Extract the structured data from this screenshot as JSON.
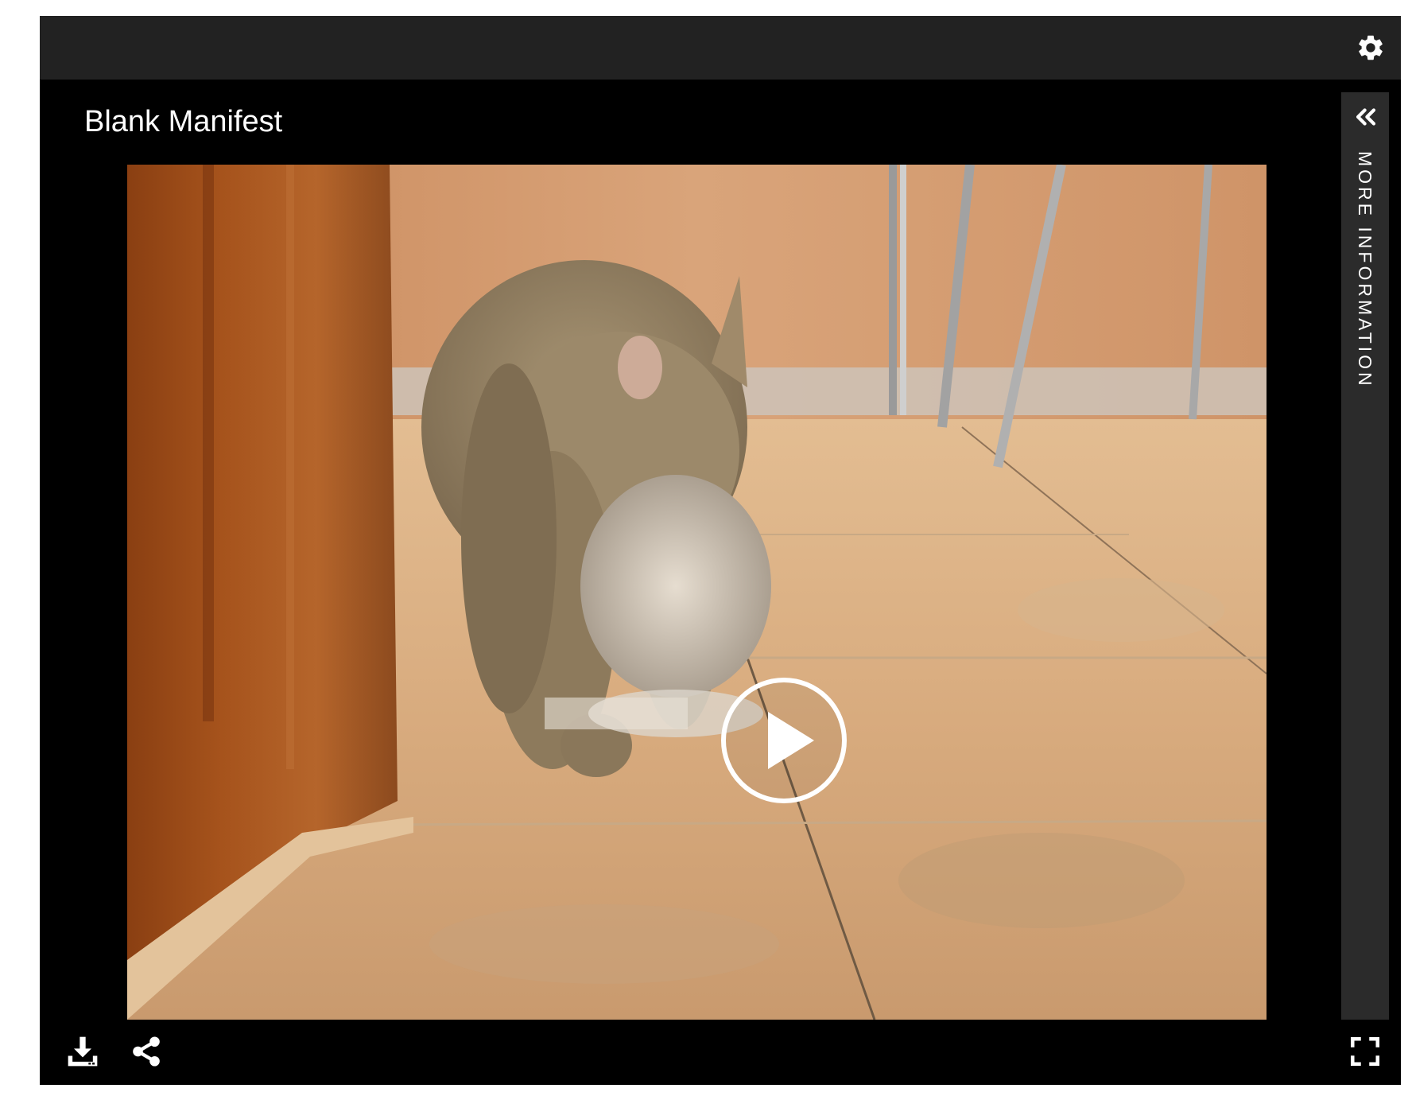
{
  "header": {
    "settings_icon": "gear-icon"
  },
  "video": {
    "title": "Blank Manifest",
    "play_icon": "play-icon"
  },
  "side_panel": {
    "label": "MORE INFORMATION",
    "icon": "double-chevron-left-icon"
  },
  "controls": {
    "download_icon": "download-icon",
    "share_icon": "share-icon",
    "fullscreen_icon": "fullscreen-icon"
  },
  "colors": {
    "player_background": "#000000",
    "topbar_background": "#222222",
    "side_panel_background": "#2b2b2b",
    "icon_color": "#ffffff"
  }
}
